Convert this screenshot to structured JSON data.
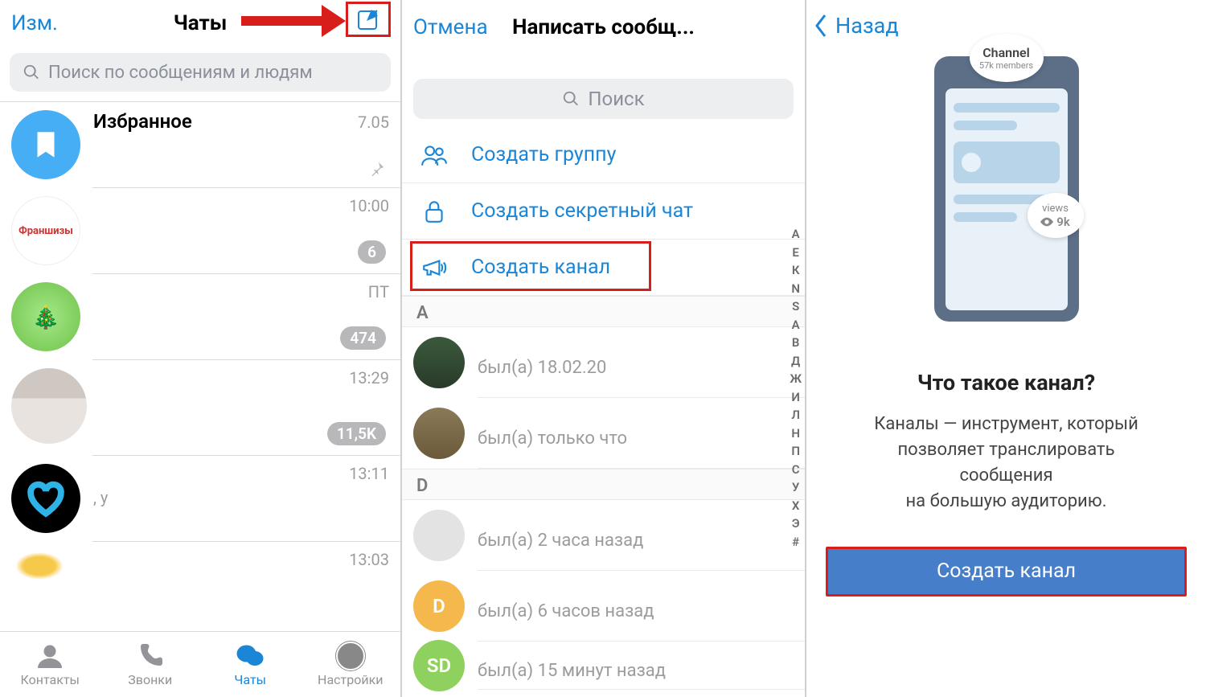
{
  "panel1": {
    "edit_label": "Изм.",
    "title": "Чаты",
    "search_placeholder": "Поиск по сообщениям и людям",
    "chats": [
      {
        "name": "Избранное",
        "time": "7.05",
        "pinned": true
      },
      {
        "name_img": "Франшизы",
        "time": "10:00",
        "badge": "6"
      },
      {
        "name": "",
        "time": "ПТ",
        "badge": "474"
      },
      {
        "name": "",
        "time": "13:29",
        "badge": "11,5K"
      },
      {
        "name": "",
        "time": "13:11",
        "sub": ", у"
      },
      {
        "name": "",
        "time": "13:03"
      }
    ],
    "tabs": {
      "contacts": "Контакты",
      "calls": "Звонки",
      "chats": "Чаты",
      "settings": "Настройки"
    }
  },
  "panel2": {
    "cancel": "Отмена",
    "title": "Написать сообщ...",
    "search": "Поиск",
    "create_group": "Создать группу",
    "create_secret": "Создать секретный чат",
    "create_channel": "Создать канал",
    "section_a": "A",
    "section_d": "D",
    "contacts": [
      {
        "status": "был(а) 18.02.20"
      },
      {
        "status": "был(а) только что"
      },
      {
        "status": "был(а) 2 часа назад"
      },
      {
        "initial": "D",
        "status": "был(а) 6 часов назад"
      },
      {
        "initial": "SD",
        "status": "был(а) 15 минут назад"
      }
    ],
    "index": [
      "А",
      "Е",
      "К",
      "N",
      "S",
      "А",
      "В",
      "Д",
      "Ж",
      "И",
      "Л",
      "Н",
      "П",
      "С",
      "У",
      "Х",
      "Э",
      "#"
    ]
  },
  "panel3": {
    "back": "Назад",
    "bubble_channel": "Channel",
    "bubble_members": "57k members",
    "bubble_views_label": "views",
    "bubble_views_count": "9k",
    "question": "Что такое канал?",
    "desc_l1": "Каналы — инструмент, который",
    "desc_l2": "позволяет транслировать",
    "desc_l3": "сообщения",
    "desc_l4": "на большую аудиторию.",
    "button": "Создать канал"
  }
}
